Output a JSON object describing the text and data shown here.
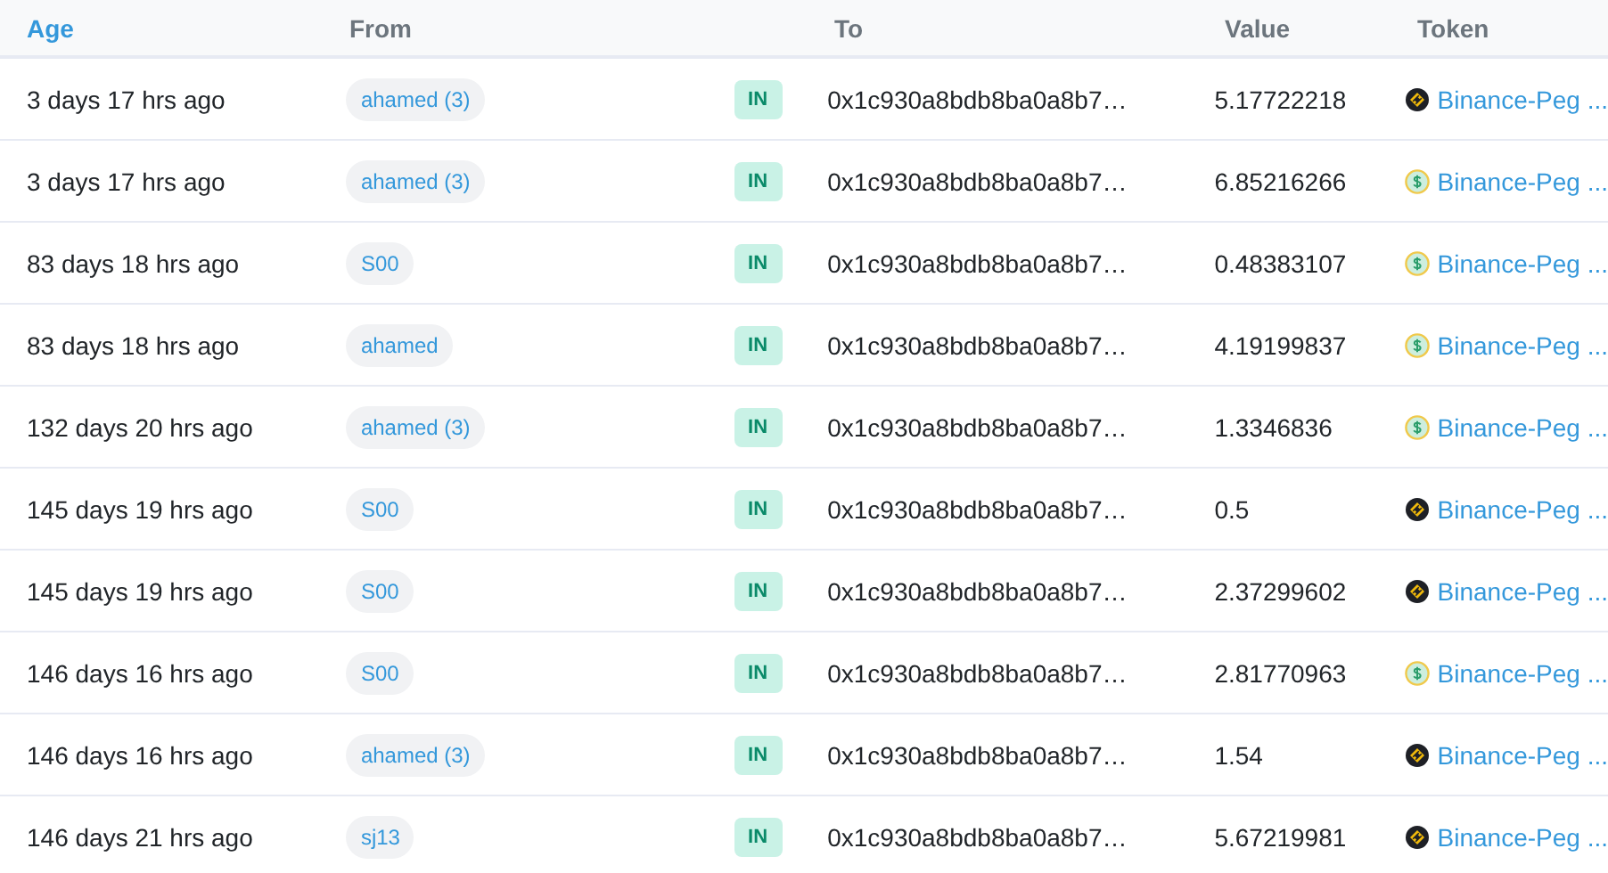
{
  "table": {
    "columns": [
      {
        "label": "Age",
        "kind": "link"
      },
      {
        "label": "From",
        "kind": "plain"
      },
      {
        "label": "To",
        "kind": "plain"
      },
      {
        "label": "Value",
        "kind": "plain"
      },
      {
        "label": "Token",
        "kind": "plain"
      }
    ],
    "rows": [
      {
        "age": "3 days 17 hrs ago",
        "from": "ahamed (3)",
        "direction": "IN",
        "to": "0x1c930a8bdb8ba0a8b7…",
        "value": "5.17722218",
        "token": {
          "kind": "bnb",
          "label": "Binance-Peg ..."
        }
      },
      {
        "age": "3 days 17 hrs ago",
        "from": "ahamed (3)",
        "direction": "IN",
        "to": "0x1c930a8bdb8ba0a8b7…",
        "value": "6.85216266",
        "token": {
          "kind": "usd",
          "label": "Binance-Peg ..."
        }
      },
      {
        "age": "83 days 18 hrs ago",
        "from": "S00",
        "direction": "IN",
        "to": "0x1c930a8bdb8ba0a8b7…",
        "value": "0.48383107",
        "token": {
          "kind": "usd",
          "label": "Binance-Peg ..."
        }
      },
      {
        "age": "83 days 18 hrs ago",
        "from": "ahamed",
        "direction": "IN",
        "to": "0x1c930a8bdb8ba0a8b7…",
        "value": "4.19199837",
        "token": {
          "kind": "usd",
          "label": "Binance-Peg ..."
        }
      },
      {
        "age": "132 days 20 hrs ago",
        "from": "ahamed (3)",
        "direction": "IN",
        "to": "0x1c930a8bdb8ba0a8b7…",
        "value": "1.3346836",
        "token": {
          "kind": "usd",
          "label": "Binance-Peg ..."
        }
      },
      {
        "age": "145 days 19 hrs ago",
        "from": "S00",
        "direction": "IN",
        "to": "0x1c930a8bdb8ba0a8b7…",
        "value": "0.5",
        "token": {
          "kind": "bnb",
          "label": "Binance-Peg ..."
        }
      },
      {
        "age": "145 days 19 hrs ago",
        "from": "S00",
        "direction": "IN",
        "to": "0x1c930a8bdb8ba0a8b7…",
        "value": "2.37299602",
        "token": {
          "kind": "bnb",
          "label": "Binance-Peg ..."
        }
      },
      {
        "age": "146 days 16 hrs ago",
        "from": "S00",
        "direction": "IN",
        "to": "0x1c930a8bdb8ba0a8b7…",
        "value": "2.81770963",
        "token": {
          "kind": "usd",
          "label": "Binance-Peg ..."
        }
      },
      {
        "age": "146 days 16 hrs ago",
        "from": "ahamed (3)",
        "direction": "IN",
        "to": "0x1c930a8bdb8ba0a8b7…",
        "value": "1.54",
        "token": {
          "kind": "bnb",
          "label": "Binance-Peg ..."
        }
      },
      {
        "age": "146 days 21 hrs ago",
        "from": "sj13",
        "direction": "IN",
        "to": "0x1c930a8bdb8ba0a8b7…",
        "value": "5.67219981",
        "token": {
          "kind": "bnb",
          "label": "Binance-Peg ..."
        }
      }
    ]
  }
}
